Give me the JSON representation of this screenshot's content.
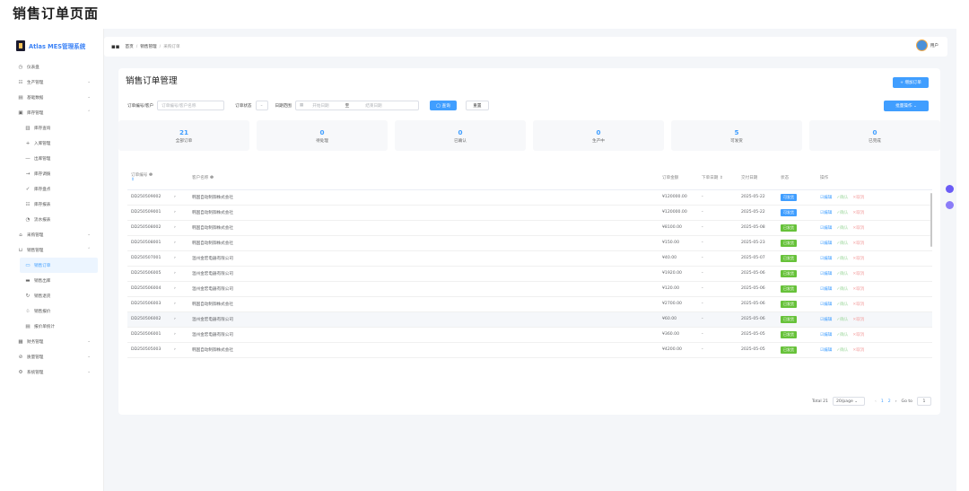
{
  "page_heading": "销售订单页面",
  "app": {
    "logo_text": "Atlas MES管理系统"
  },
  "sidebar": {
    "items": [
      {
        "icon": "◷",
        "label": "仪表盘"
      },
      {
        "icon": "☷",
        "label": "生产管理",
        "chev": "⌄"
      },
      {
        "icon": "▤",
        "label": "基础数据",
        "chev": "⌄"
      },
      {
        "icon": "▣",
        "label": "库存管理",
        "chev": "⌃"
      },
      {
        "icon": "▥",
        "label": "库存查询",
        "sub": true
      },
      {
        "icon": "+",
        "label": "入库管理",
        "sub": true
      },
      {
        "icon": "—",
        "label": "出库管理",
        "sub": true
      },
      {
        "icon": "→",
        "label": "库存调拨",
        "sub": true
      },
      {
        "icon": "✓",
        "label": "库存盘点",
        "sub": true
      },
      {
        "icon": "☷",
        "label": "库存报表",
        "sub": true
      },
      {
        "icon": "◔",
        "label": "流水报表",
        "sub": true
      },
      {
        "icon": "⌂",
        "label": "采购管理",
        "chev": "⌄"
      },
      {
        "icon": "⊔",
        "label": "销售管理",
        "chev": "⌃"
      },
      {
        "icon": "▭",
        "label": "销售订单",
        "sub": true,
        "active": true
      },
      {
        "icon": "▬",
        "label": "销售出库",
        "sub": true
      },
      {
        "icon": "↻",
        "label": "销售退货",
        "sub": true
      },
      {
        "icon": "♧",
        "label": "销售报价",
        "sub": true
      },
      {
        "icon": "▤",
        "label": "报价单统计",
        "sub": true
      },
      {
        "icon": "▦",
        "label": "财务管理",
        "chev": "⌄"
      },
      {
        "icon": "⊘",
        "label": "质量管理",
        "chev": "⌄"
      },
      {
        "icon": "⚙",
        "label": "系统管理",
        "chev": "⌄"
      }
    ]
  },
  "topbar": {
    "breadcrumb": [
      "首页",
      "销售管理",
      "采购订单"
    ],
    "user_label": "用户"
  },
  "main": {
    "title": "销售订单管理",
    "add_button": "+ 增加订单",
    "batch_button": "批量操作 ⌄",
    "filters": {
      "order_label": "订单编号/客户",
      "order_placeholder": "订单编号/客户名称",
      "status_label": "订单状态",
      "status_value": "⌄",
      "date_label": "日期范围",
      "date_icon": "▦",
      "date_start": "开始日期",
      "date_sep": "至",
      "date_end": "结束日期",
      "query_button": "◯ 查询",
      "reset_button": "重置"
    },
    "stats": [
      {
        "num": "21",
        "label": "全部订单"
      },
      {
        "num": "0",
        "label": "待处理"
      },
      {
        "num": "0",
        "label": "已确认"
      },
      {
        "num": "0",
        "label": "生产中"
      },
      {
        "num": "5",
        "label": "可发货"
      },
      {
        "num": "0",
        "label": "已完成"
      }
    ],
    "table": {
      "headers": [
        "订单编号 ❶",
        "",
        "客户名称 ❶",
        "订单金额",
        "下单日期 ⇕",
        "交付日期",
        "状态",
        "操作"
      ],
      "sort_mark": "⇕",
      "ops": [
        "☑编辑",
        "✓确认",
        "✕取消"
      ],
      "rows": [
        {
          "id": "DD250509002",
          "expand": "›",
          "customer": "韩国自动制御株式会社",
          "amount": "¥120000.00",
          "order_date": "-",
          "delivery": "2025-05-22",
          "status": "可发货",
          "status_color": "#409eff"
        },
        {
          "id": "DD250509001",
          "expand": "›",
          "customer": "韩国自动制御株式会社",
          "amount": "¥120000.00",
          "order_date": "-",
          "delivery": "2025-05-22",
          "status": "可发货",
          "status_color": "#409eff"
        },
        {
          "id": "DD250508002",
          "expand": "›",
          "customer": "韩国自动制御株式会社",
          "amount": "¥8100.00",
          "order_date": "-",
          "delivery": "2025-05-08",
          "status": "已发货",
          "status_color": "#67c23a"
        },
        {
          "id": "DD250508001",
          "expand": "›",
          "customer": "韩国自动制御株式会社",
          "amount": "¥150.00",
          "order_date": "-",
          "delivery": "2025-05-23",
          "status": "已发货",
          "status_color": "#67c23a"
        },
        {
          "id": "DD250507001",
          "expand": "›",
          "customer": "温州金宏电器有限公司",
          "amount": "¥40.00",
          "order_date": "-",
          "delivery": "2025-05-07",
          "status": "已发货",
          "status_color": "#67c23a"
        },
        {
          "id": "DD250506005",
          "expand": "›",
          "customer": "温州金宏电器有限公司",
          "amount": "¥1920.00",
          "order_date": "-",
          "delivery": "2025-05-06",
          "status": "已发货",
          "status_color": "#67c23a"
        },
        {
          "id": "DD250506004",
          "expand": "›",
          "customer": "温州金宏电器有限公司",
          "amount": "¥120.00",
          "order_date": "-",
          "delivery": "2025-05-06",
          "status": "已发货",
          "status_color": "#67c23a"
        },
        {
          "id": "DD250506003",
          "expand": "›",
          "customer": "韩国自动制御株式会社",
          "amount": "¥2700.00",
          "order_date": "-",
          "delivery": "2025-05-06",
          "status": "已发货",
          "status_color": "#67c23a"
        },
        {
          "id": "DD250506002",
          "expand": "›",
          "customer": "温州金宏电器有限公司",
          "amount": "¥60.00",
          "order_date": "-",
          "delivery": "2025-05-06",
          "status": "已发货",
          "status_color": "#67c23a"
        },
        {
          "id": "DD250506001",
          "expand": "›",
          "customer": "温州金宏电器有限公司",
          "amount": "¥360.00",
          "order_date": "-",
          "delivery": "2025-05-05",
          "status": "已发货",
          "status_color": "#67c23a"
        },
        {
          "id": "DD250505003",
          "expand": "›",
          "customer": "韩国自动制御株式会社",
          "amount": "¥4200.00",
          "order_date": "-",
          "delivery": "2025-05-05",
          "status": "已发货",
          "status_color": "#67c23a"
        }
      ]
    },
    "pagination": {
      "total": "Total 21",
      "page_size": "20/page ⌄",
      "prev": "‹",
      "pages": [
        "1",
        "2"
      ],
      "next": "›",
      "goto_label": "Go to",
      "goto_value": "1"
    }
  }
}
